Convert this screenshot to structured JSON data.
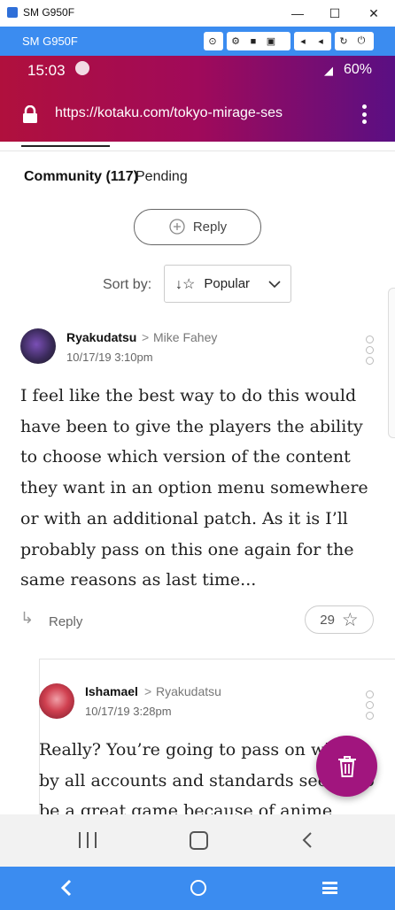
{
  "window": {
    "title": "SM G950F",
    "minimize": "—",
    "maximize": "☐",
    "close": "✕"
  },
  "toolbar": {
    "device": "SM G950F"
  },
  "status": {
    "time": "15:03",
    "battery": "60%"
  },
  "browser": {
    "url": "https://kotaku.com/tokyo-mirage-ses"
  },
  "tabs": {
    "community": "Community (117)",
    "pending": "Pending"
  },
  "reply_button": "Reply",
  "sort": {
    "label": "Sort by:",
    "value": "Popular"
  },
  "comments": [
    {
      "author": "Ryakudatsu",
      "reply_to": "Mike Fahey",
      "timestamp": "10/17/19 3:10pm",
      "body": "I feel like the best way to do this would have been to give the players the ability to choose which version of the content they want in an option menu somewhere or with an additional patch. As it is I’ll probably pass on this one again for the same reasons as last time...",
      "reply_label": "Reply",
      "stars": "29"
    },
    {
      "author": "Ishamael",
      "reply_to": "Ryakudatsu",
      "timestamp": "10/17/19 3:28pm",
      "body": "Really? You’re going to pass on what by all accounts and standards seems to be a great game because of anime pantsu?"
    }
  ],
  "colors": {
    "accent": "#3b8cf0",
    "fab": "#a1157e"
  },
  "icons": {
    "lock": "lock-icon",
    "menu": "kebab-menu-icon",
    "fab": "trash-icon"
  }
}
